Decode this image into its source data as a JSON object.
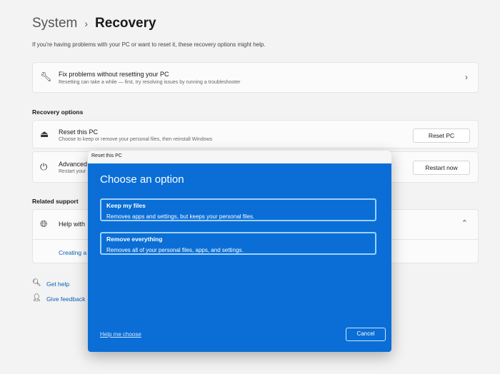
{
  "breadcrumb": {
    "parent": "System",
    "separator": "›",
    "current": "Recovery"
  },
  "intro": "If you're having problems with your PC or want to reset it, these recovery options might help.",
  "fix": {
    "title": "Fix problems without resetting your PC",
    "subtitle": "Resetting can take a while — first, try resolving issues by running a troubleshooter"
  },
  "recovery_options": {
    "heading": "Recovery options",
    "reset": {
      "title": "Reset this PC",
      "subtitle": "Choose to keep or remove your personal files, then reinstall Windows",
      "button": "Reset PC"
    },
    "advanced": {
      "title": "Advanced",
      "subtitle": "Restart your",
      "button": "Restart now"
    }
  },
  "related": {
    "heading": "Related support",
    "help_title": "Help with",
    "creating": "Creating a"
  },
  "footer_links": {
    "get_help": "Get help",
    "feedback": "Give feedback"
  },
  "dialog": {
    "title_bar": "Reset this PC",
    "heading": "Choose an option",
    "options": [
      {
        "title": "Keep my files",
        "desc": "Removes apps and settings, but keeps your personal files."
      },
      {
        "title": "Remove everything",
        "desc": "Removes all of your personal files, apps, and settings."
      }
    ],
    "help_link": "Help me choose",
    "cancel": "Cancel"
  },
  "colors": {
    "dialog_blue": "#0a6ed6"
  }
}
